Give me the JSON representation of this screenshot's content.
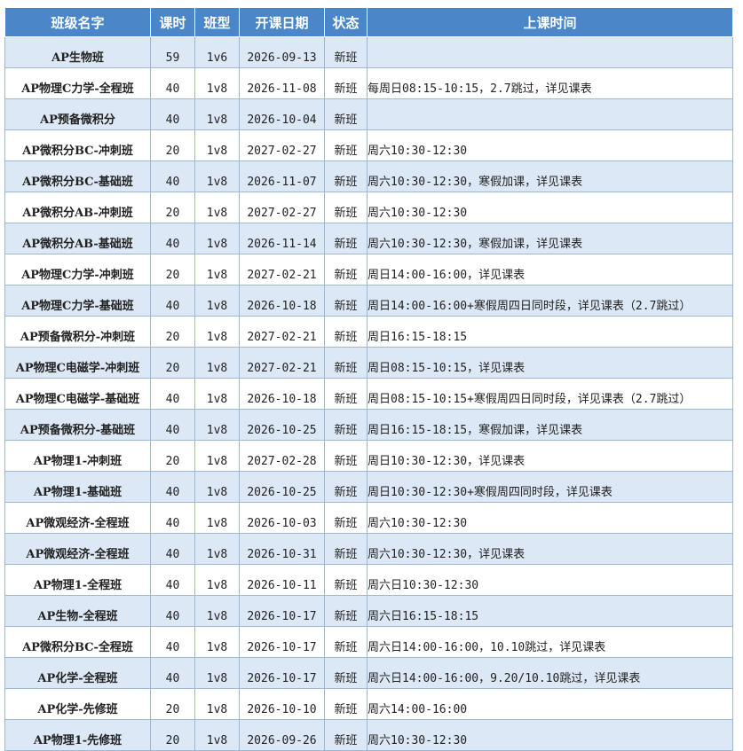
{
  "headers": [
    "班级名字",
    "课时",
    "班型",
    "开课日期",
    "状态",
    "上课时间"
  ],
  "rows": [
    {
      "name": "AP生物班",
      "hours": "59",
      "type": "1v6",
      "date": "2026-09-13",
      "status": "新班",
      "time": ""
    },
    {
      "name": "AP物理C力学-全程班",
      "hours": "40",
      "type": "1v8",
      "date": "2026-11-08",
      "status": "新班",
      "time": "每周日08:15-10:15，2.7跳过，详见课表"
    },
    {
      "name": "AP预备微积分",
      "hours": "40",
      "type": "1v8",
      "date": "2026-10-04",
      "status": "新班",
      "time": ""
    },
    {
      "name": "AP微积分BC-冲刺班",
      "hours": "20",
      "type": "1v8",
      "date": "2027-02-27",
      "status": "新班",
      "time": "周六10:30-12:30"
    },
    {
      "name": "AP微积分BC-基础班",
      "hours": "40",
      "type": "1v8",
      "date": "2026-11-07",
      "status": "新班",
      "time": "周六10:30-12:30，寒假加课，详见课表"
    },
    {
      "name": "AP微积分AB-冲刺班",
      "hours": "20",
      "type": "1v8",
      "date": "2027-02-27",
      "status": "新班",
      "time": "周六10:30-12:30"
    },
    {
      "name": "AP微积分AB-基础班",
      "hours": "40",
      "type": "1v8",
      "date": "2026-11-14",
      "status": "新班",
      "time": "周六10:30-12:30，寒假加课，详见课表"
    },
    {
      "name": "AP物理C力学-冲刺班",
      "hours": "20",
      "type": "1v8",
      "date": "2027-02-21",
      "status": "新班",
      "time": "周日14:00-16:00，详见课表"
    },
    {
      "name": "AP物理C力学-基础班",
      "hours": "40",
      "type": "1v8",
      "date": "2026-10-18",
      "status": "新班",
      "time": "周日14:00-16:00+寒假周四日同时段，详见课表（2.7跳过）"
    },
    {
      "name": "AP预备微积分-冲刺班",
      "hours": "20",
      "type": "1v8",
      "date": "2027-02-21",
      "status": "新班",
      "time": "周日16:15-18:15"
    },
    {
      "name": "AP物理C电磁学-冲刺班",
      "hours": "20",
      "type": "1v8",
      "date": "2027-02-21",
      "status": "新班",
      "time": "周日08:15-10:15，详见课表"
    },
    {
      "name": "AP物理C电磁学-基础班",
      "hours": "40",
      "type": "1v8",
      "date": "2026-10-18",
      "status": "新班",
      "time": "周日08:15-10:15+寒假周四日同时段，详见课表（2.7跳过）"
    },
    {
      "name": "AP预备微积分-基础班",
      "hours": "40",
      "type": "1v8",
      "date": "2026-10-25",
      "status": "新班",
      "time": "周日16:15-18:15，寒假加课，详见课表"
    },
    {
      "name": "AP物理1-冲刺班",
      "hours": "20",
      "type": "1v8",
      "date": "2027-02-28",
      "status": "新班",
      "time": "周日10:30-12:30，详见课表"
    },
    {
      "name": "AP物理1-基础班",
      "hours": "40",
      "type": "1v8",
      "date": "2026-10-25",
      "status": "新班",
      "time": "周日10:30-12:30+寒假周四同时段，详见课表"
    },
    {
      "name": "AP微观经济-全程班",
      "hours": "40",
      "type": "1v8",
      "date": "2026-10-03",
      "status": "新班",
      "time": "周六10:30-12:30"
    },
    {
      "name": "AP微观经济-全程班",
      "hours": "40",
      "type": "1v8",
      "date": "2026-10-31",
      "status": "新班",
      "time": "周六10:30-12:30，详见课表"
    },
    {
      "name": "AP物理1-全程班",
      "hours": "40",
      "type": "1v8",
      "date": "2026-10-11",
      "status": "新班",
      "time": "周六日10:30-12:30"
    },
    {
      "name": "AP生物-全程班",
      "hours": "40",
      "type": "1v8",
      "date": "2026-10-17",
      "status": "新班",
      "time": "周六日16:15-18:15"
    },
    {
      "name": "AP微积分BC-全程班",
      "hours": "40",
      "type": "1v8",
      "date": "2026-10-17",
      "status": "新班",
      "time": "周六日14:00-16:00，10.10跳过，详见课表"
    },
    {
      "name": "AP化学-全程班",
      "hours": "40",
      "type": "1v8",
      "date": "2026-10-17",
      "status": "新班",
      "time": "周六日14:00-16:00，9.20/10.10跳过，详见课表"
    },
    {
      "name": "AP化学-先修班",
      "hours": "20",
      "type": "1v8",
      "date": "2026-10-10",
      "status": "新班",
      "time": "周六14:00-16:00"
    },
    {
      "name": "AP物理1-先修班",
      "hours": "20",
      "type": "1v8",
      "date": "2026-09-26",
      "status": "新班",
      "time": "周六10:30-12:30"
    }
  ]
}
